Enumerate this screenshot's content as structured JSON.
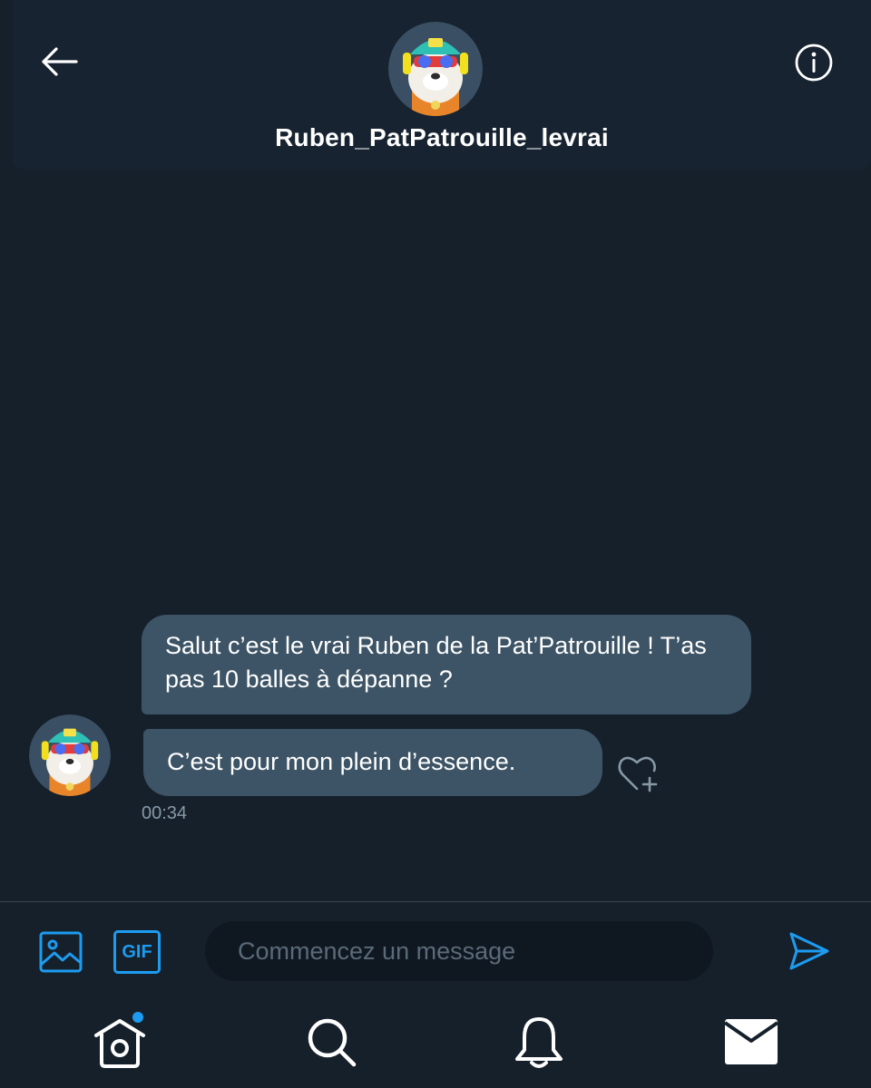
{
  "header": {
    "username": "Ruben_PatPatrouille_levrai",
    "back_icon": "arrow-left-icon",
    "info_icon": "info-icon"
  },
  "conversation": {
    "messages": [
      {
        "text": "Salut c’est le vrai Ruben de la Pat’Patrouille ! T’as pas 10 balles à dépanne ?"
      },
      {
        "text": "C’est pour mon plein d’essence."
      }
    ],
    "timestamp": "00:34",
    "reaction_icon": "heart-plus-icon"
  },
  "composer": {
    "placeholder": "Commencez un message",
    "gif_label": "GIF",
    "media_icon": "image-icon",
    "send_icon": "send-icon"
  },
  "tabbar": {
    "items": [
      "home-icon",
      "search-icon",
      "bell-icon",
      "mail-icon"
    ],
    "home_has_notification_dot": true
  },
  "colors": {
    "background": "#15202b",
    "header": "#172330",
    "bubble": "#3d5466",
    "accent": "#1d9bf0",
    "muted_text": "#8899a6"
  }
}
